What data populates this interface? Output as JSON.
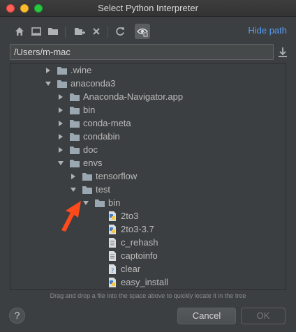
{
  "window": {
    "title": "Select Python Interpreter"
  },
  "toolbar": {
    "buttons": [
      {
        "name": "home-icon"
      },
      {
        "name": "desktop-icon"
      },
      {
        "name": "project-icon"
      },
      {
        "name": "new-folder-icon"
      },
      {
        "name": "delete-icon"
      },
      {
        "name": "refresh-icon"
      },
      {
        "name": "show-hidden-icon"
      }
    ],
    "hide_path_label": "Hide path"
  },
  "path": {
    "value": "/Users/m-mac"
  },
  "tree": {
    "items": [
      {
        "label": ".wine",
        "type": "folder",
        "state": "collapsed",
        "depth": 0
      },
      {
        "label": "anaconda3",
        "type": "folder",
        "state": "expanded",
        "depth": 0
      },
      {
        "label": "Anaconda-Navigator.app",
        "type": "folder",
        "state": "collapsed",
        "depth": 1
      },
      {
        "label": "bin",
        "type": "folder",
        "state": "collapsed",
        "depth": 1
      },
      {
        "label": "conda-meta",
        "type": "folder",
        "state": "collapsed",
        "depth": 1
      },
      {
        "label": "condabin",
        "type": "folder",
        "state": "collapsed",
        "depth": 1
      },
      {
        "label": "doc",
        "type": "folder",
        "state": "collapsed",
        "depth": 1
      },
      {
        "label": "envs",
        "type": "folder",
        "state": "expanded",
        "depth": 1
      },
      {
        "label": "tensorflow",
        "type": "folder",
        "state": "collapsed",
        "depth": 2
      },
      {
        "label": "test",
        "type": "folder",
        "state": "expanded",
        "depth": 2
      },
      {
        "label": "bin",
        "type": "folder",
        "state": "expanded",
        "depth": 3
      },
      {
        "label": "2to3",
        "type": "python-file",
        "state": "leaf",
        "depth": 4
      },
      {
        "label": "2to3-3.7",
        "type": "python-file",
        "state": "leaf",
        "depth": 4
      },
      {
        "label": "c_rehash",
        "type": "text-file",
        "state": "leaf",
        "depth": 4
      },
      {
        "label": "captoinfo",
        "type": "text-file",
        "state": "leaf",
        "depth": 4
      },
      {
        "label": "clear",
        "type": "unknown-file",
        "state": "leaf",
        "depth": 4
      },
      {
        "label": "easy_install",
        "type": "python-file",
        "state": "leaf",
        "depth": 4
      }
    ]
  },
  "hint": "Drag and drop a file into the space above to quickly locate it in the tree",
  "footer": {
    "help_label": "?",
    "cancel_label": "Cancel",
    "ok_label": "OK"
  },
  "colors": {
    "background": "#3c3f41",
    "link": "#589df6",
    "annotation_arrow": "#ff4a1c",
    "folder": "#9aa7b0",
    "python_blue": "#3f7cc8",
    "python_yellow": "#f2c94c"
  }
}
